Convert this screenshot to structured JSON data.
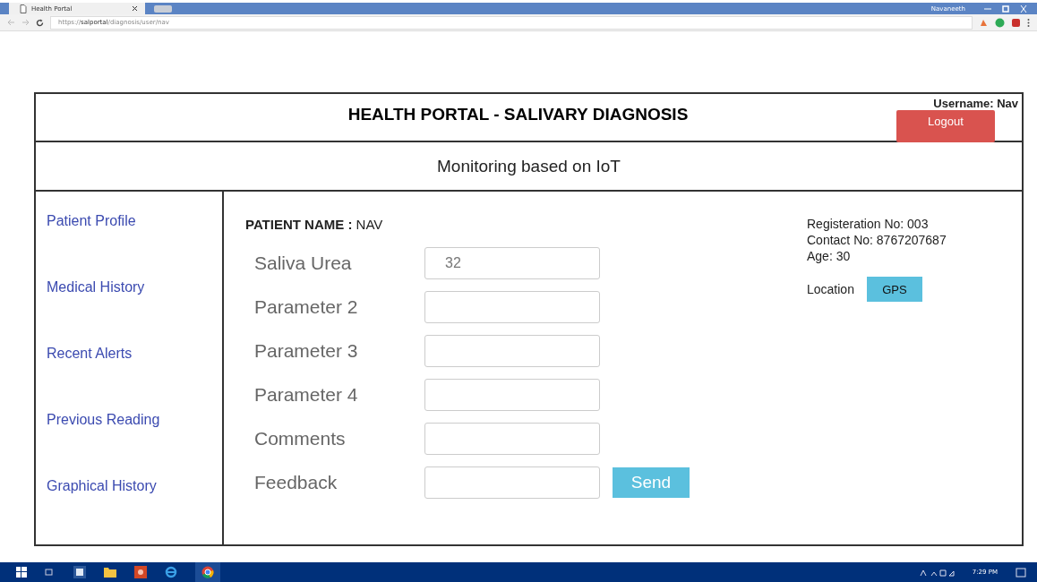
{
  "browser": {
    "tab_title": "Health Portal",
    "user": "Navaneeth",
    "url_prefix": "https://",
    "url_host": "salportal",
    "url_path": "/diagnosis/user/nav"
  },
  "header": {
    "title": "HEALTH PORTAL - SALIVARY DIAGNOSIS",
    "username": "Username: Nav",
    "logout": "Logout",
    "subtitle": "Monitoring based on IoT"
  },
  "sidebar": {
    "items": [
      {
        "label": "Patient Profile"
      },
      {
        "label": "Medical History"
      },
      {
        "label": "Recent Alerts"
      },
      {
        "label": "Previous Reading"
      },
      {
        "label": "Graphical History"
      }
    ]
  },
  "patient": {
    "name": "**PATIENT NAME :** NAV",
    "registration": "Registeration No: 003",
    "contact": "Contact No: 8767207687",
    "age": "Age: 30",
    "location_label": "Location",
    "gps_button": "GPS"
  },
  "form": {
    "fields": [
      {
        "label": "Saliva Urea",
        "value": "32"
      },
      {
        "label": "Parameter 2"
      },
      {
        "label": "Parameter 3"
      },
      {
        "label": "Parameter 4"
      },
      {
        "label": "Comments"
      },
      {
        "label": "Feedback"
      }
    ],
    "send_button": "Send"
  },
  "taskbar": {
    "clock": "7:29 PM"
  }
}
